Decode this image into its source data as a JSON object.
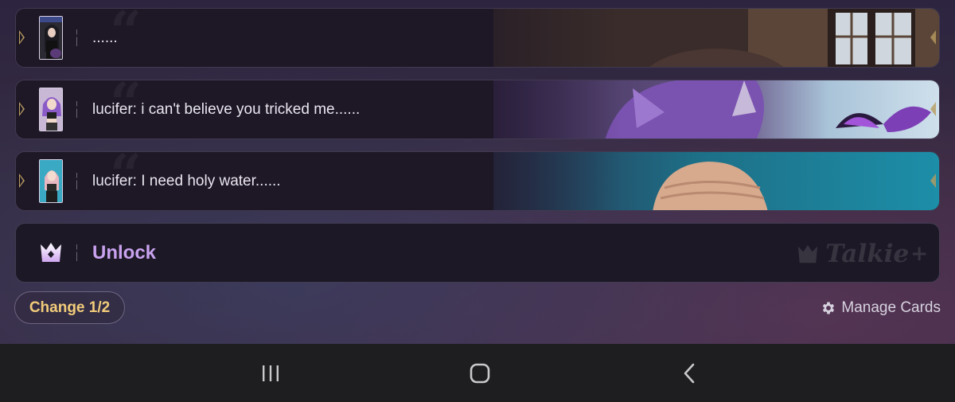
{
  "cards": [
    {
      "message": "......",
      "avatar": "anime-character-card-1"
    },
    {
      "message": "lucifer: i can't believe you tricked me......",
      "avatar": "anime-character-card-2"
    },
    {
      "message": "lucifer: I need holy water......",
      "avatar": "anime-character-card-3"
    }
  ],
  "unlock": {
    "label": "Unlock",
    "icon": "crown-icon",
    "brand": "Talkie",
    "brand_plus": "+"
  },
  "footer": {
    "change_label": "Change 1/2",
    "manage_label": "Manage Cards",
    "manage_icon": "gear-icon"
  },
  "navbar": {
    "recent": "recent-apps-icon",
    "home": "home-icon",
    "back": "back-icon"
  },
  "colors": {
    "accent_gold": "#f2cc7a",
    "unlock_purple": "#c9a2ef",
    "chevron_gold": "#b89b5f"
  }
}
